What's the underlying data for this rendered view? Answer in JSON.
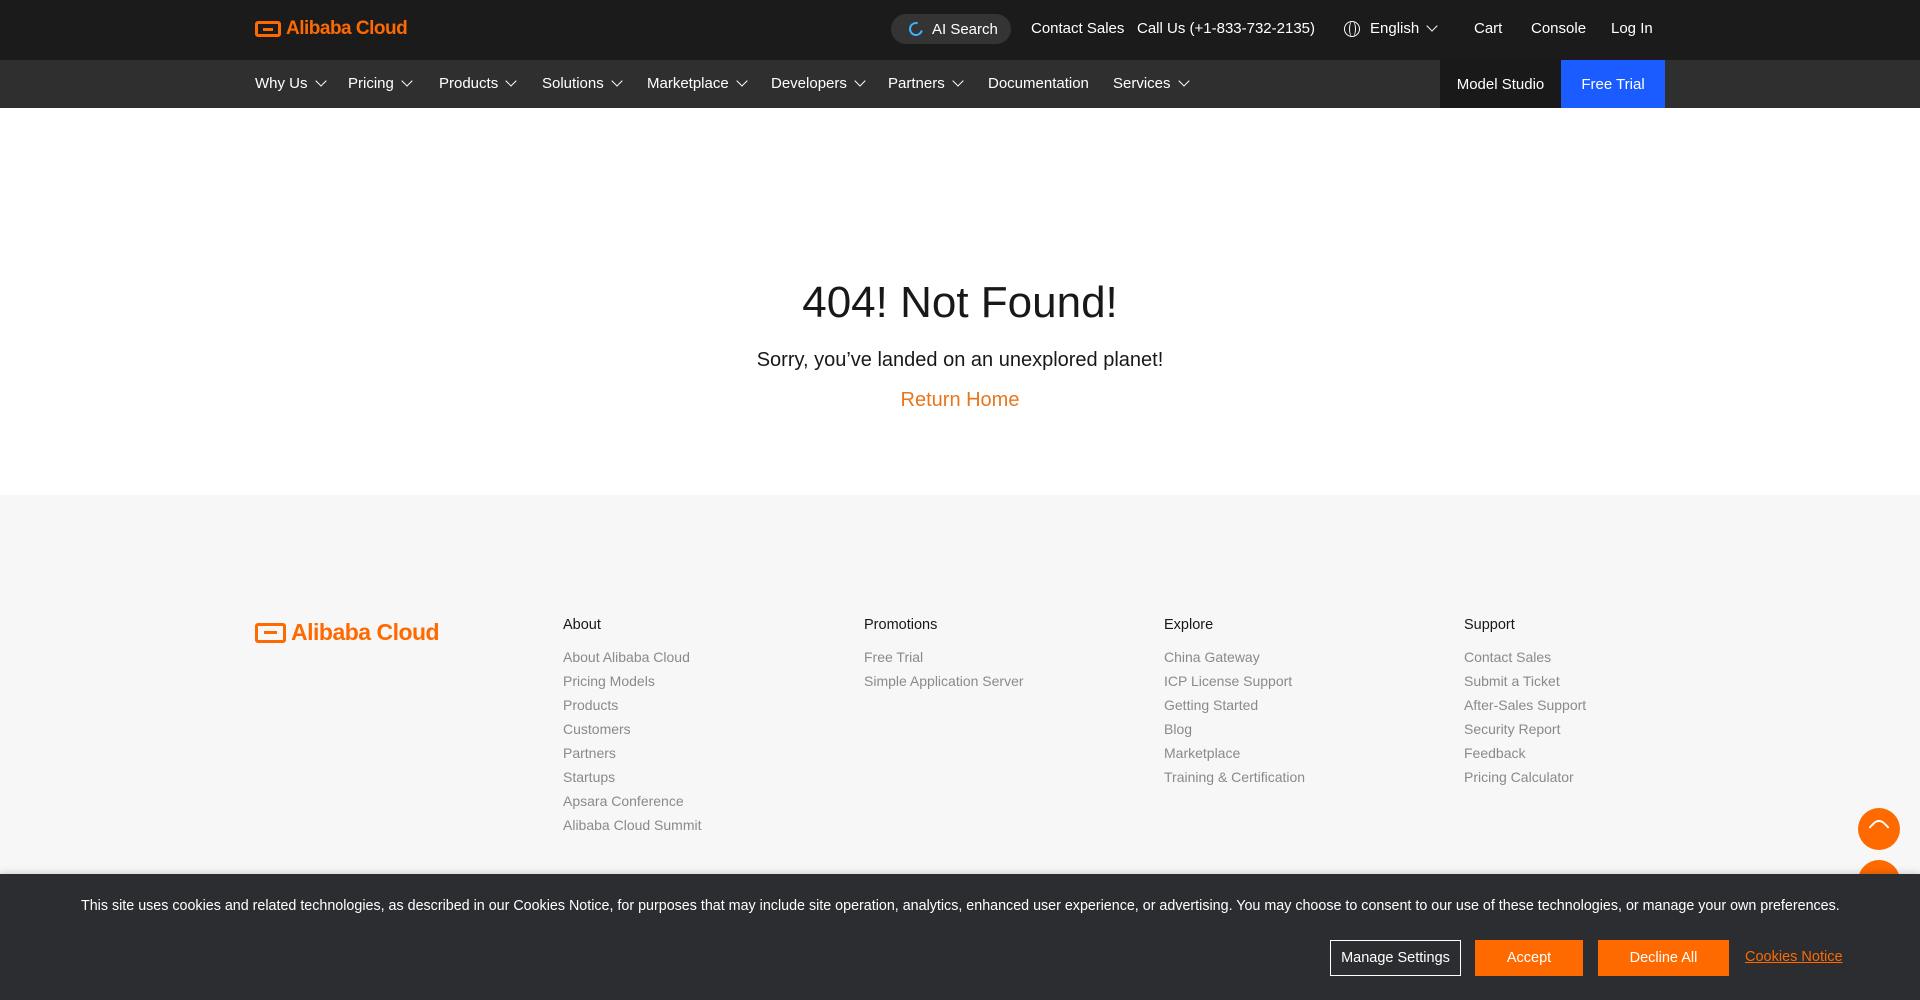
{
  "header": {
    "logo_text": "Alibaba Cloud",
    "ai_search_label": "AI Search",
    "contact_sales": "Contact Sales",
    "call_us": "Call Us (+1-833-732-2135)",
    "language": "English",
    "cart": "Cart",
    "console": "Console",
    "login": "Log In"
  },
  "nav": {
    "items": [
      "Why Us",
      "Pricing",
      "Products",
      "Solutions",
      "Marketplace",
      "Developers",
      "Partners",
      "Documentation",
      "Services"
    ],
    "model_studio": "Model Studio",
    "free_trial": "Free Trial"
  },
  "main": {
    "title": "404! Not Found!",
    "subtitle": "Sorry, you’ve landed on an unexplored planet!",
    "return_home": "Return Home"
  },
  "footer": {
    "logo_text": "Alibaba Cloud",
    "columns": [
      {
        "heading": "About",
        "links": [
          "About Alibaba Cloud",
          "Pricing Models",
          "Products",
          "Customers",
          "Partners",
          "Startups",
          "Apsara Conference",
          "Alibaba Cloud Summit"
        ]
      },
      {
        "heading": "Promotions",
        "links": [
          "Free Trial",
          "Simple Application Server"
        ]
      },
      {
        "heading": "Explore",
        "links": [
          "China Gateway",
          "ICP License Support",
          "Getting Started",
          "Blog",
          "Marketplace",
          "Training & Certification"
        ]
      },
      {
        "heading": "Support",
        "links": [
          "Contact Sales",
          "Submit a Ticket",
          "After-Sales Support",
          "Security Report",
          "Feedback",
          "Pricing Calculator"
        ]
      }
    ]
  },
  "cookie_banner": {
    "text": "This site uses cookies and related technologies, as described in our Cookies Notice, for purposes that may include site operation, analytics, enhanced user experience, or advertising. You may choose to consent to our use of these technologies, or manage your own preferences.",
    "manage_settings": "Manage Settings",
    "accept": "Accept",
    "decline_all": "Decline All",
    "cookies_notice": "Cookies Notice"
  },
  "colors": {
    "brand_orange": "#ff6a00",
    "link_orange": "#e8761c",
    "free_trial_blue": "#1a5cff",
    "top_bar": "#1b1b1b",
    "nav_bar": "#2f2f2f"
  },
  "icons": [
    "alibaba-cloud-logo",
    "ai-search-icon",
    "globe-icon",
    "chevron-down-icon",
    "phone-icon"
  ]
}
